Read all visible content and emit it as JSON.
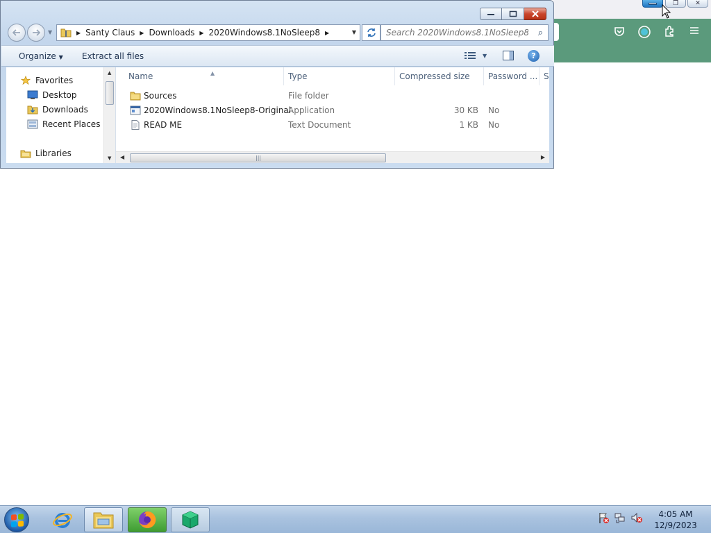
{
  "explorer": {
    "breadcrumb": [
      "Santy Claus",
      "Downloads",
      "2020Windows8.1NoSleep8"
    ],
    "search_placeholder": "Search 2020Windows8.1NoSleep8",
    "toolbar": {
      "organize": "Organize",
      "extract": "Extract all files"
    },
    "nav_pane": {
      "favorites": "Favorites",
      "desktop": "Desktop",
      "downloads": "Downloads",
      "recent_places": "Recent Places",
      "libraries": "Libraries"
    },
    "columns": {
      "name": "Name",
      "type": "Type",
      "compressed_size": "Compressed size",
      "password": "Password ...",
      "size": "Si"
    },
    "files": [
      {
        "name": "Sources",
        "type": "File folder",
        "compressed_size": "",
        "password": "",
        "icon": "folder-icon"
      },
      {
        "name": "2020Windows8.1NoSleep8-Original",
        "type": "Application",
        "compressed_size": "30 KB",
        "password": "No",
        "icon": "application-icon"
      },
      {
        "name": "READ ME",
        "type": "Text Document",
        "compressed_size": "1 KB",
        "password": "No",
        "icon": "text-document-icon"
      }
    ]
  },
  "taskbar": {
    "time": "4:05 AM",
    "date": "12/9/2023",
    "apps": [
      "internet-explorer-icon",
      "windows-explorer-icon",
      "firefox-icon",
      "package-icon"
    ]
  },
  "colors": {
    "browser_toolbar": "#5b9a7c",
    "close_button": "#c9462c",
    "taskbar": "#a9c2df"
  }
}
